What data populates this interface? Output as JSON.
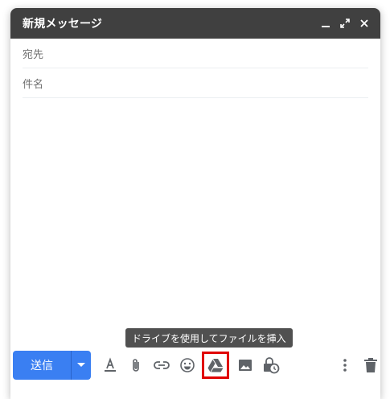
{
  "header": {
    "title": "新規メッセージ"
  },
  "fields": {
    "to_label": "宛先",
    "subject_label": "件名"
  },
  "tooltip": {
    "text": "ドライブを使用してファイルを挿入"
  },
  "toolbar": {
    "send_label": "送信"
  },
  "colors": {
    "header_bg": "#404040",
    "send_button": "#3a7ff2",
    "highlight": "#e00000",
    "icon": "#5f6368"
  },
  "icons": {
    "minimize": "minimize-icon",
    "expand": "expand-icon",
    "close": "close-icon",
    "send_options": "chevron-down-icon",
    "formatting": "text-format-icon",
    "attach": "paperclip-icon",
    "link": "link-icon",
    "emoji": "emoji-icon",
    "drive": "google-drive-icon",
    "photo": "image-icon",
    "confidential": "lock-clock-icon",
    "more": "more-vert-icon",
    "discard": "trash-icon"
  }
}
